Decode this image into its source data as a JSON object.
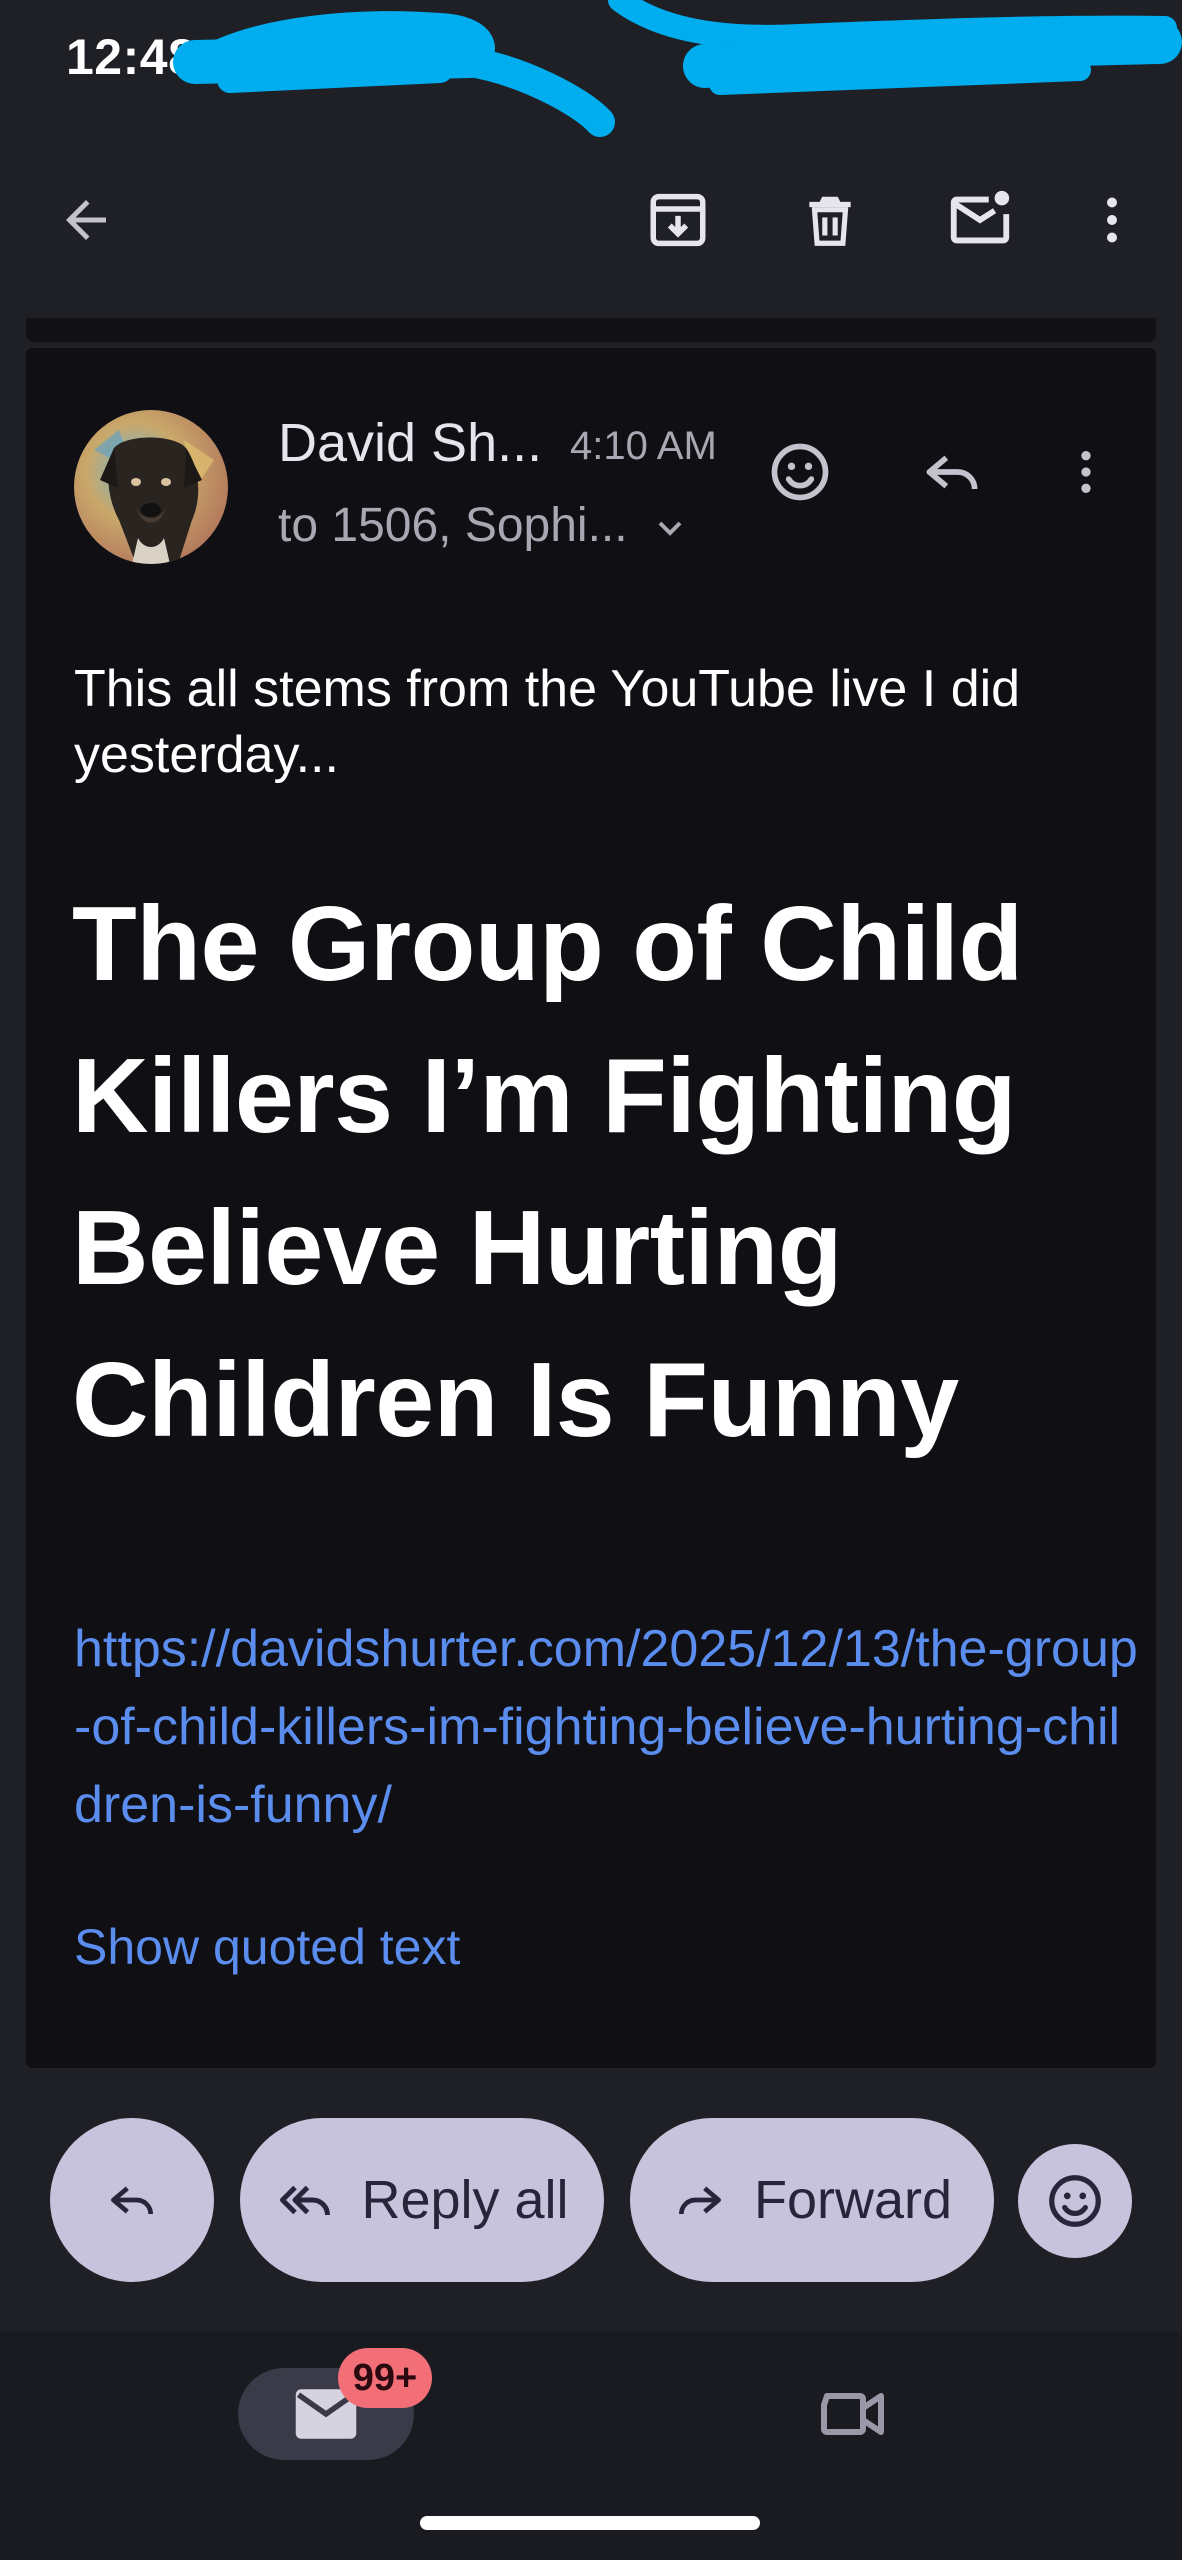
{
  "status_bar": {
    "time": "12:48"
  },
  "app_bar": {
    "icons": [
      "arrow-back-icon",
      "archive-icon",
      "delete-icon",
      "mark-unread-icon",
      "more-vert-icon"
    ]
  },
  "message": {
    "sender_name": "David Sh...",
    "time": "4:10 AM",
    "recipients": "to 1506, Sophi...",
    "intro_text": "This all stems from the YouTube live I did yesterday...",
    "headline": "The Group of Child Killers I’m Fighting Believe Hurting Children Is Funny",
    "link": "https://davidshurter.com/2025/12/13/the-group-of-child-killers-im-fighting-believe-hurting-children-is-funny/",
    "show_quoted": "Show quoted text"
  },
  "actions": {
    "reply_all": "Reply all",
    "forward": "Forward"
  },
  "bottom_nav": {
    "mail_badge": "99+"
  },
  "colors": {
    "background": "#1f1f26",
    "card": "#0f0f14",
    "link": "#5b8def",
    "pill": "#c7c3dd",
    "badge": "#f26f78",
    "redaction": "#00adef"
  }
}
